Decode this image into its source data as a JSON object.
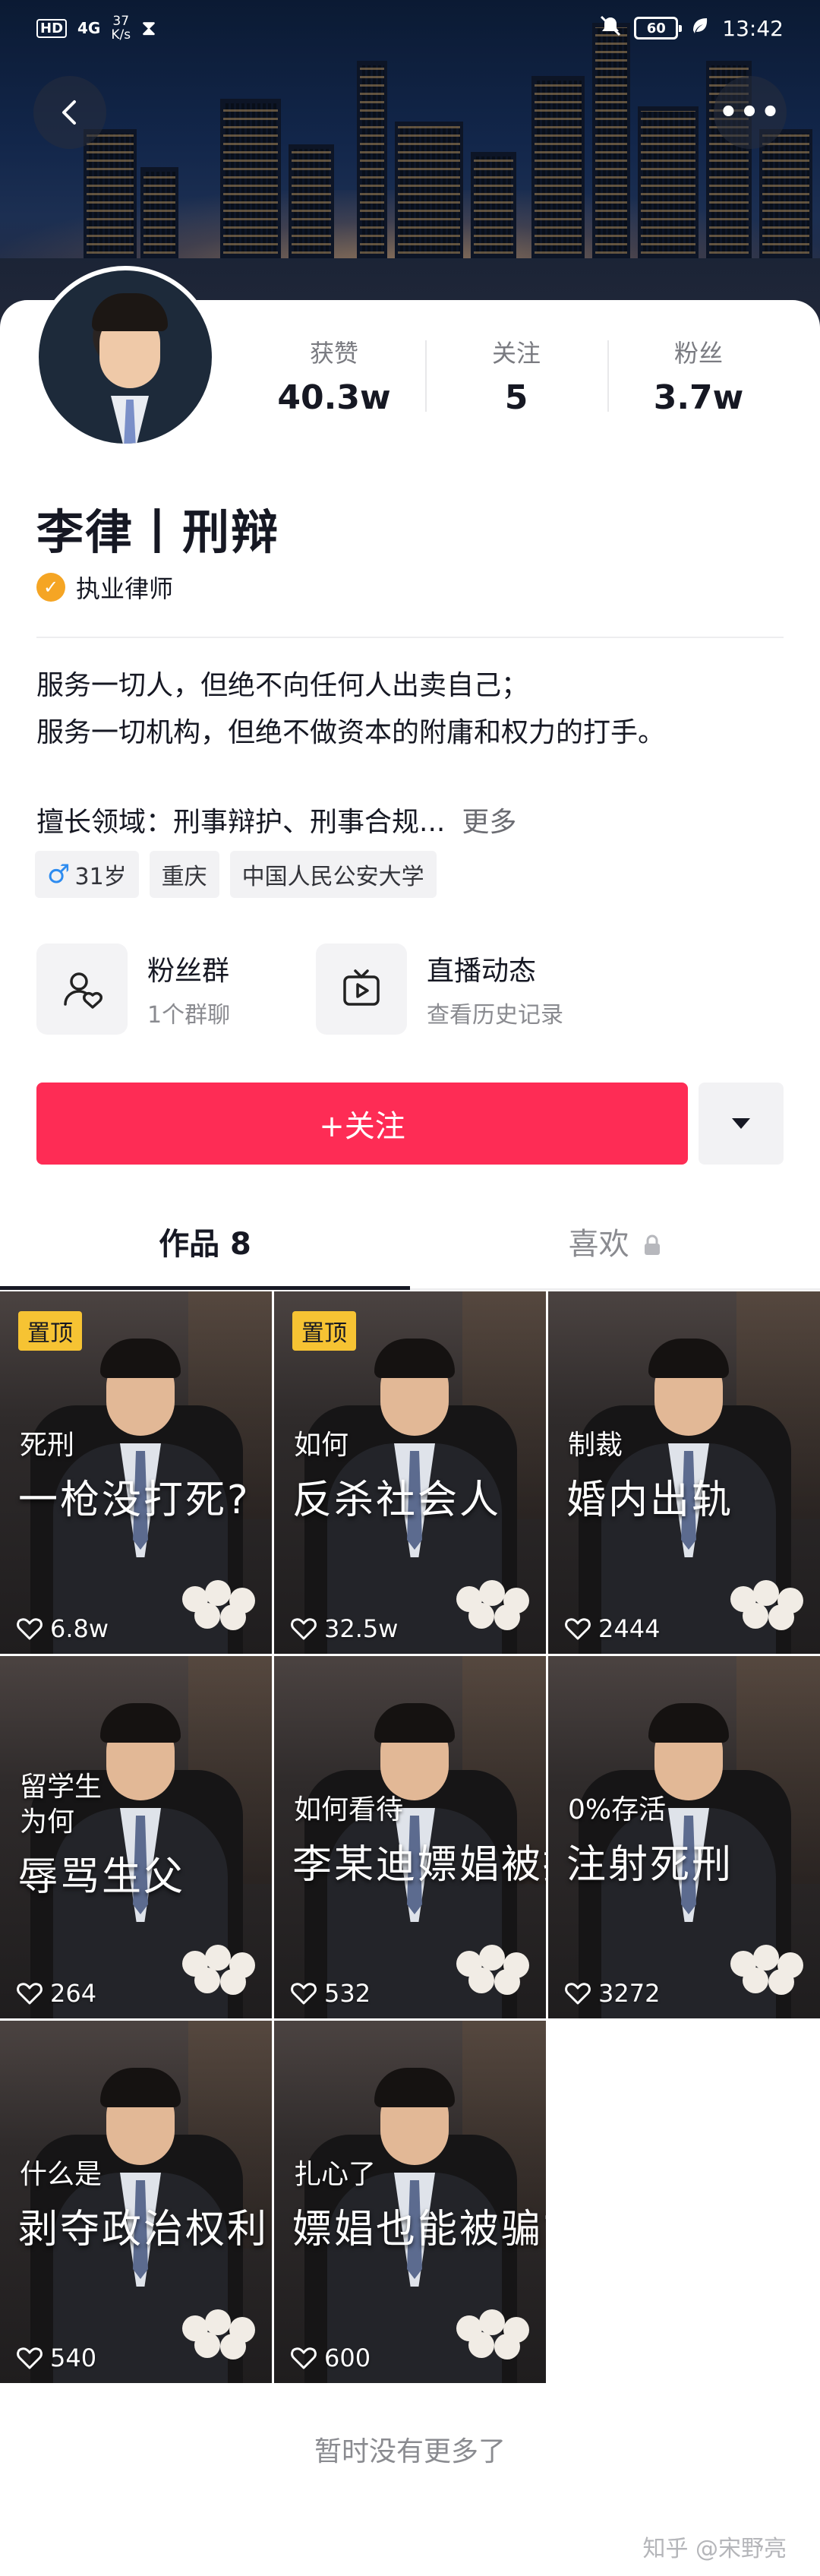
{
  "status_bar": {
    "hd": "HD",
    "signal": "4G",
    "net_speed_value": "37",
    "net_speed_unit": "K/s",
    "battery": "60",
    "time": "13:42"
  },
  "profile": {
    "name": "李律丨刑辩",
    "verify_label": "执业律师",
    "stats": [
      {
        "label": "获赞",
        "value": "40.3w"
      },
      {
        "label": "关注",
        "value": "5"
      },
      {
        "label": "粉丝",
        "value": "3.7w"
      }
    ],
    "bio_line1": "服务一切人，但绝不向任何人出卖自己；",
    "bio_line2": "服务一切机构，但绝不做资本的附庸和权力的打手。",
    "skills": "擅长领域：刑事辩护、刑事合规...",
    "skills_more": "更多",
    "tags": {
      "age": "31岁",
      "city": "重庆",
      "school": "中国人民公安大学"
    }
  },
  "quick_actions": {
    "fans_group_title": "粉丝群",
    "fans_group_sub": "1个群聊",
    "live_title": "直播动态",
    "live_sub": "查看历史记录"
  },
  "actions": {
    "follow_label": "+关注"
  },
  "tabs": {
    "works": "作品 8",
    "likes": "喜欢"
  },
  "videos": [
    {
      "pin": "置顶",
      "small": "死刑",
      "big": "一枪没打死?",
      "likes": "6.8w"
    },
    {
      "pin": "置顶",
      "small": "如何",
      "big": "反杀社会人",
      "likes": "32.5w"
    },
    {
      "pin": "",
      "small": "制裁",
      "big": "婚内出轨",
      "likes": "2444"
    },
    {
      "pin": "",
      "small": "留学生\n为何",
      "big": "辱骂生父",
      "likes": "264"
    },
    {
      "pin": "",
      "small": "如何看待",
      "big": "李某迪嫖娼被拘",
      "likes": "532"
    },
    {
      "pin": "",
      "small": "0%存活",
      "big": "注射死刑",
      "likes": "3272"
    },
    {
      "pin": "",
      "small": "什么是",
      "big": "剥夺政治权利",
      "likes": "540"
    },
    {
      "pin": "",
      "small": "扎心了",
      "big": "嫖娼也能被骗?",
      "likes": "600"
    }
  ],
  "footer": {
    "end_text": "暂时没有更多了",
    "watermark": "知乎 @宋野亮"
  }
}
